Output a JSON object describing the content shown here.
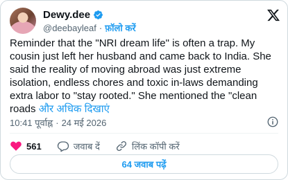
{
  "user": {
    "display_name": "Dewy.dee",
    "handle": "@deebayleaf",
    "separator": "·",
    "follow_label": "फ़ॉलो करें"
  },
  "tweet": {
    "text": "Reminder that the \"NRI dream life\" is often a trap. My cousin just left her husband and came back to India. She said the reality of moving abroad was just extreme isolation, endless chores and toxic in-laws demanding extra labor to \"stay rooted.\" She mentioned the \"clean roads ",
    "show_more": "और अधिक दिखाएं"
  },
  "meta": {
    "time": "10:41 पूर्वाह्न",
    "separator": "·",
    "date": "24 मई 2026"
  },
  "actions": {
    "like_count": "561",
    "reply_label": "जवाब दें",
    "copy_link_label": "लिंक कॉपी करें"
  },
  "replies_button": "64 जवाब पढ़ें",
  "colors": {
    "accent": "#1d9bf0",
    "like": "#f91880",
    "text": "#0f1419",
    "muted": "#536471"
  }
}
